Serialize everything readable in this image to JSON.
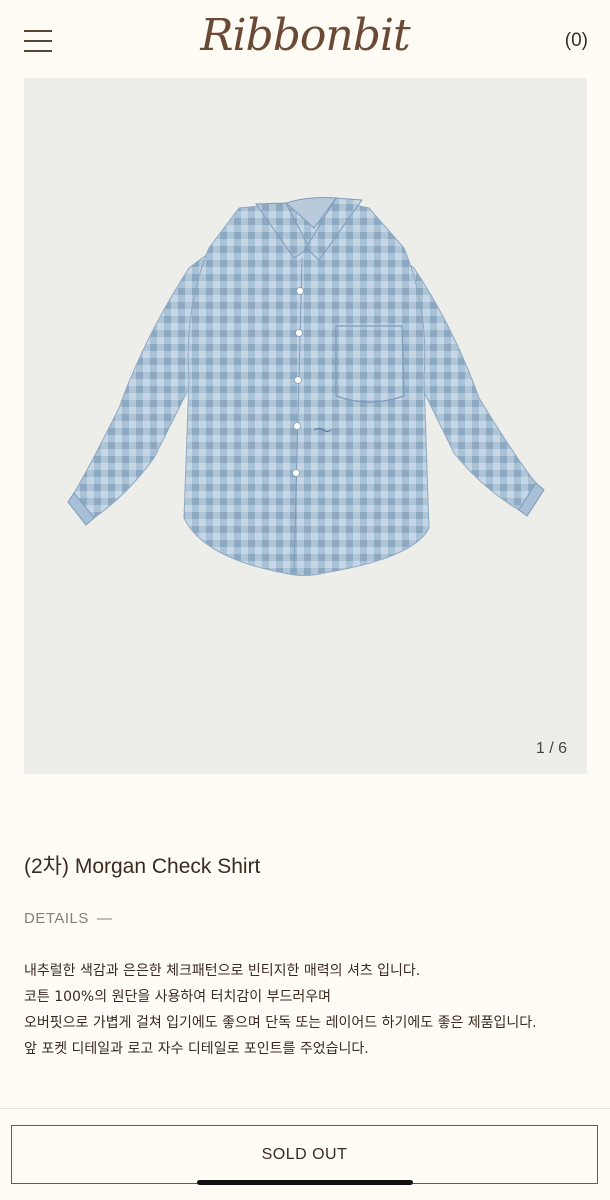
{
  "header": {
    "logo": "Ribbonbit",
    "cart_label": "(0)"
  },
  "gallery": {
    "counter": "1 / 6",
    "image_subject": "shirt-photo"
  },
  "product": {
    "title": "(2차) Morgan Check Shirt",
    "details_label": "DETAILS",
    "details_toggle": "—",
    "description": [
      "내추럴한 색감과 은은한 체크패턴으로 빈티지한 매력의 셔츠 입니다.",
      "코튼 100%의 원단을 사용하여 터치감이 부드러우며",
      "오버핏으로 가볍게 걸쳐 입기에도 좋으며 단독 또는 레이어드 하기에도 좋은 제품입니다.",
      "앞 포켓 디테일과 로고 자수 디테일로 포인트를 주었습니다."
    ]
  },
  "actions": {
    "sold_out_label": "SOLD OUT"
  },
  "colors": {
    "background": "#fffcf6",
    "logo": "#6b4a35",
    "gallery_bg": "#ededea",
    "shirt_blue": "#a9c2d8"
  }
}
